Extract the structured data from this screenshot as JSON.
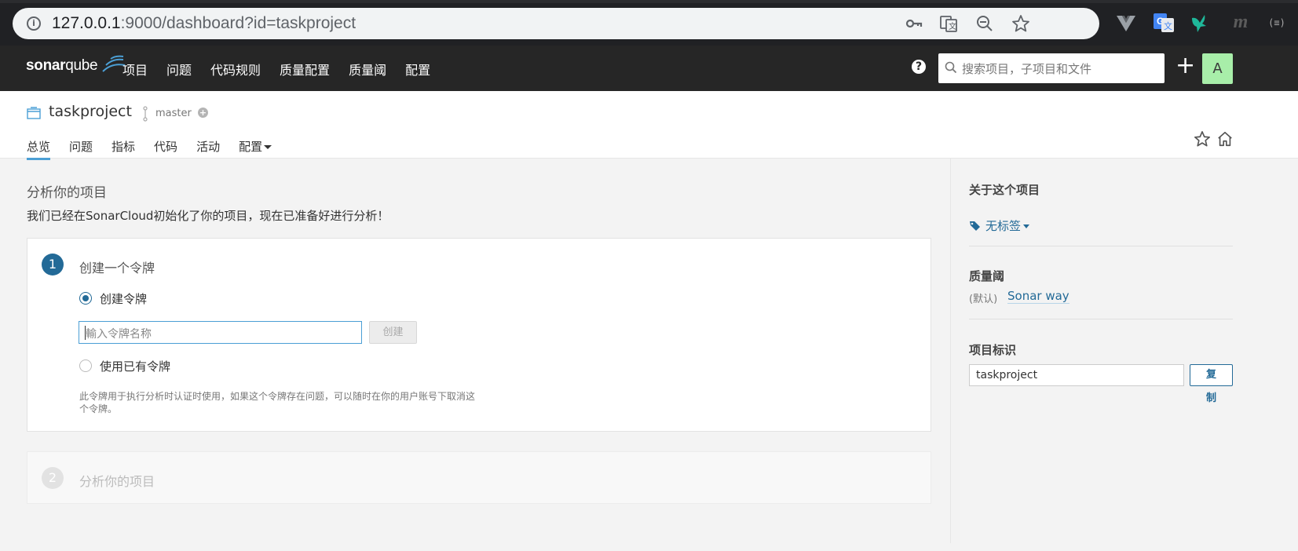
{
  "browser": {
    "url_host": "127.0.0.1",
    "url_rest": ":9000/dashboard?id=taskproject",
    "icons": [
      "info-icon",
      "key-icon",
      "translate-icon",
      "zoom-out-icon",
      "bookmark-star-icon"
    ],
    "extensions": [
      "vue-devtools-icon",
      "google-translate-icon",
      "bird-extension-icon",
      "m-extension-icon",
      "extension-icon"
    ],
    "ext_m_glyph": "m",
    "ext_last_glyph": "(≡)"
  },
  "nav": {
    "logo_bold": "sonar",
    "logo_lite": "qube",
    "links": [
      "项目",
      "问题",
      "代码规则",
      "质量配置",
      "质量阈",
      "配置"
    ],
    "help_glyph": "?",
    "search_placeholder": "搜索项目，子项目和文件",
    "plus_glyph": "+",
    "avatar_letter": "A"
  },
  "project": {
    "name": "taskproject",
    "branch": "master",
    "branch_add_glyph": "+",
    "tabs": [
      "总览",
      "问题",
      "指标",
      "代码",
      "活动",
      "配置"
    ],
    "active_tab": "总览"
  },
  "main": {
    "title": "分析你的项目",
    "subtitle": "我们已经在SonarCloud初始化了你的项目，现在已准备好进行分析！",
    "step1": {
      "number": "1",
      "title": "创建一个令牌",
      "option_create": "创建令牌",
      "token_placeholder": "輸入令牌名称",
      "create_button": "创建",
      "option_existing": "使用已有令牌",
      "note": "此令牌用于执行分析时认证时使用，如果这个令牌存在问题，可以随时在你的用户账号下取消这个令牌。"
    },
    "step2": {
      "number": "2",
      "title": "分析你的项目"
    }
  },
  "sidebar": {
    "about_title": "关于这个项目",
    "tags_label": "无标签",
    "quality_gate_title": "质量阈",
    "default_label": "(默认)",
    "quality_gate_value": "Sonar way",
    "key_title": "项目标识",
    "key_value": "taskproject",
    "copy_line1": "复",
    "copy_line2": "制"
  },
  "colors": {
    "accent": "#236a97",
    "active_tab": "#4b9fd5",
    "navbar": "#262626",
    "avatar_bg": "#a8eea9"
  }
}
